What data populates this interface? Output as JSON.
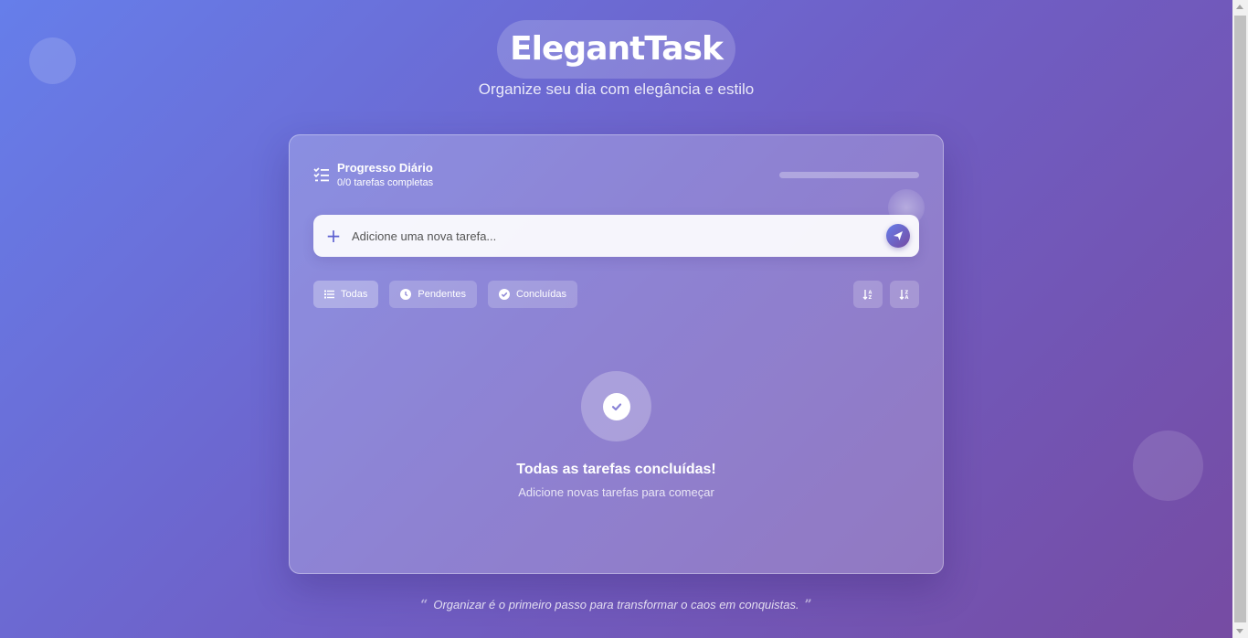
{
  "header": {
    "brand": "ElegantTask",
    "subtitle": "Organize seu dia com elegância e estilo"
  },
  "progress": {
    "title": "Progresso Diário",
    "count_text": "0/0 tarefas completas",
    "fraction": 0,
    "icon": "list-check-icon"
  },
  "add_task": {
    "placeholder": "Adicione uma nova tarefa...",
    "plus_icon": "plus-icon",
    "send_icon": "paper-plane-icon"
  },
  "filters": [
    {
      "label": "Todas",
      "icon": "list-icon",
      "active": true
    },
    {
      "label": "Pendentes",
      "icon": "clock-icon",
      "active": false
    },
    {
      "label": "Concluídas",
      "icon": "check-circle-icon",
      "active": false
    }
  ],
  "sort": [
    {
      "icon": "sort-alpha-asc-icon"
    },
    {
      "icon": "sort-alpha-desc-icon"
    }
  ],
  "empty_state": {
    "icon": "check-circle-icon",
    "title": "Todas as tarefas concluídas!",
    "subtitle": "Adicione novas tarefas para começar"
  },
  "quote": {
    "text": "Organizar é o primeiro passo para transformar o caos em conquistas."
  },
  "colors": {
    "gradient_start": "#667eea",
    "gradient_end": "#764ba2",
    "accent": "#5b5fd0"
  }
}
